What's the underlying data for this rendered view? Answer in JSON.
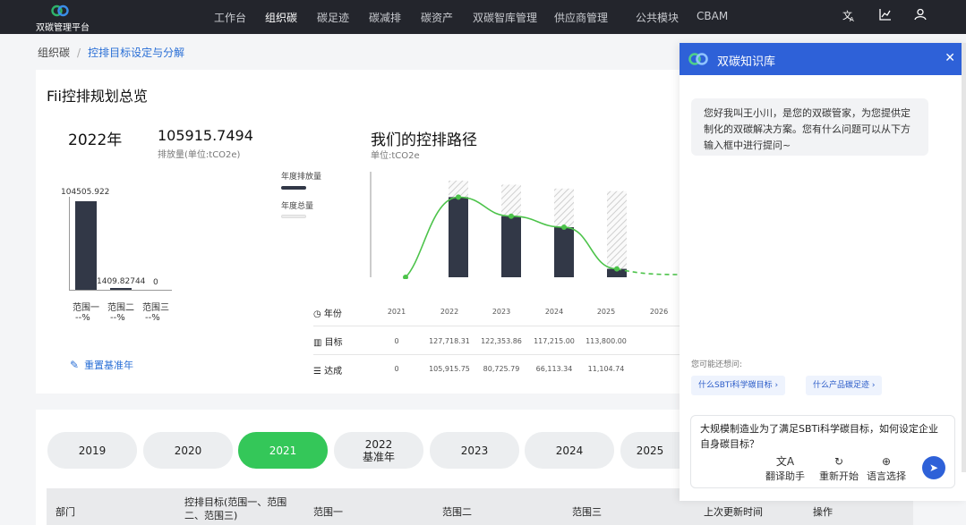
{
  "app": {
    "logo_text": "双碳管理平台"
  },
  "nav": {
    "items": [
      {
        "label": "工作台",
        "active": false
      },
      {
        "label": "组织碳",
        "active": true
      },
      {
        "label": "碳足迹",
        "active": false
      },
      {
        "label": "碳减排",
        "active": false
      },
      {
        "label": "碳资产",
        "active": false
      },
      {
        "label": "双碳智库管理",
        "active": false
      },
      {
        "label": "供应商管理",
        "active": false
      },
      {
        "label": "公共模块",
        "active": false
      },
      {
        "label": "CBAM",
        "active": false
      }
    ],
    "icons": [
      "translate-icon",
      "chart-icon",
      "user-icon"
    ]
  },
  "breadcrumb": {
    "root": "组织碳",
    "current": "控排目标设定与分解"
  },
  "overview": {
    "title": "Fii控排规划总览",
    "year": "2022年",
    "total": "105915.7494",
    "total_unit": "排放量(单位:tCO2e)",
    "mini_chart": {
      "values": [
        "104505.922",
        "1409.82744",
        "0"
      ],
      "categories": [
        "范围一",
        "范围二",
        "范围三"
      ],
      "percents": [
        "--%",
        "--%",
        "--%"
      ]
    },
    "reset_label": "重置基准年"
  },
  "path_chart": {
    "title": "我们的控排路径",
    "unit": "单位:tCO2e",
    "legend": {
      "annual_emission": "年度排放量",
      "annual_total": "年度总量"
    },
    "row_labels": {
      "year": "年份",
      "target": "目标",
      "achieved": "达成"
    },
    "years": [
      "2021",
      "2022",
      "2023",
      "2024",
      "2025",
      "2026"
    ],
    "targets": [
      "0",
      "127,718.31",
      "122,353.86",
      "117,215.00",
      "113,800.00"
    ],
    "achieved": [
      "0",
      "105,915.75",
      "80,725.79",
      "66,113.34",
      "11,104.74"
    ]
  },
  "chart_data": {
    "type": "bar",
    "title": "我们的控排路径",
    "categories": [
      "2021",
      "2022",
      "2023",
      "2024",
      "2025",
      "2026"
    ],
    "series": [
      {
        "name": "年度排放量",
        "values": [
          0,
          105915.75,
          80725.79,
          66113.34,
          11104.74,
          null
        ]
      },
      {
        "name": "年度总量",
        "values": [
          0,
          127718.31,
          122353.86,
          117215.0,
          113800.0,
          null
        ]
      }
    ],
    "ylabel": "单位:tCO2e",
    "ylim": [
      0,
      130000
    ]
  },
  "year_tabs": [
    {
      "label": "2019",
      "sub": "",
      "active": false
    },
    {
      "label": "2020",
      "sub": "",
      "active": false
    },
    {
      "label": "2021",
      "sub": "",
      "active": true
    },
    {
      "label": "2022",
      "sub": "基准年",
      "active": false
    },
    {
      "label": "2023",
      "sub": "",
      "active": false
    },
    {
      "label": "2024",
      "sub": "",
      "active": false
    },
    {
      "label": "2025",
      "sub": "",
      "active": false
    }
  ],
  "table": {
    "headers": [
      "部门",
      "控排目标(范围一、范围二、范围三)",
      "范围一",
      "范围二",
      "范围三",
      "上次更新时间",
      "操作"
    ]
  },
  "chat": {
    "title": "双碳知识库",
    "greeting": "您好我叫王小川，是您的双碳管家，为您提供定制化的双碳解决方案。您有什么问题可以从下方输入框中进行提问~",
    "suggest_label": "您可能还想问:",
    "chips": [
      "什么SBTi科学碳目标",
      "什么产品碳足迹"
    ],
    "input_value": "大规模制造业为了满足SBTi科学碳目标，如何设定企业自身碳目标？",
    "tools": {
      "translate": "翻译助手",
      "restart": "重新开始",
      "language": "语言选择"
    }
  }
}
